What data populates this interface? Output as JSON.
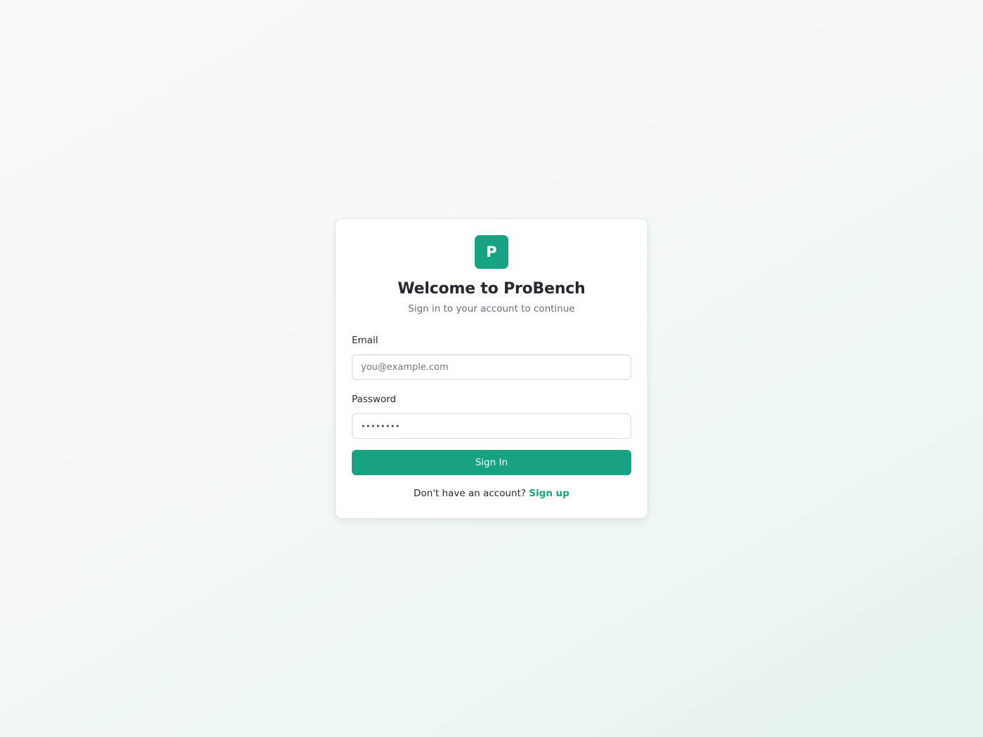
{
  "brand": {
    "logo_letter": "P",
    "accent_color": "#17a383"
  },
  "header": {
    "title": "Welcome to ProBench",
    "subtitle": "Sign in to your account to continue"
  },
  "form": {
    "email": {
      "label": "Email",
      "placeholder": "you@example.com",
      "value": ""
    },
    "password": {
      "label": "Password",
      "value": "••••••••"
    },
    "submit_label": "Sign In"
  },
  "footer": {
    "prompt": "Don't have an account?",
    "link_label": "Sign up"
  }
}
